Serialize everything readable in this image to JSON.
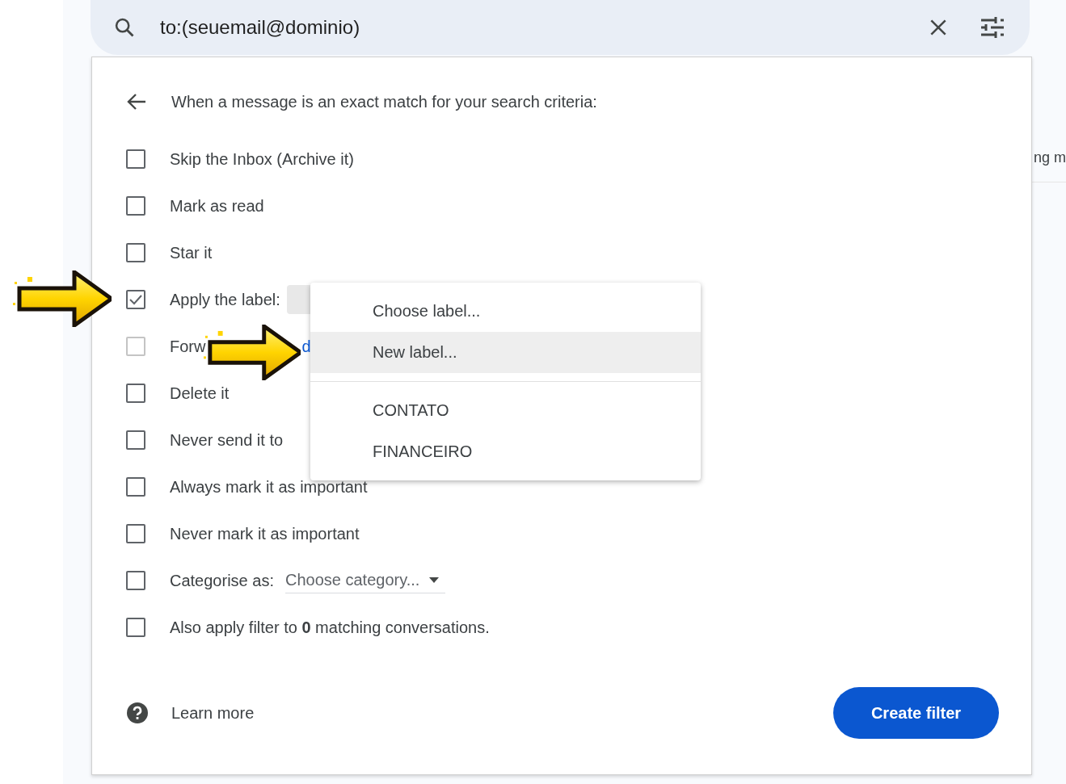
{
  "search": {
    "value": "to:(seuemail@dominio)"
  },
  "background_text": "ng m",
  "filter": {
    "heading": "When a message is an exact match for your search criteria:",
    "options": [
      {
        "kind": "plain",
        "label": "Skip the Inbox (Archive it)",
        "checked": false,
        "disabled": false
      },
      {
        "kind": "plain",
        "label": "Mark as read",
        "checked": false,
        "disabled": false
      },
      {
        "kind": "plain",
        "label": "Star it",
        "checked": false,
        "disabled": false
      },
      {
        "kind": "label_select",
        "label": "Apply the label:",
        "checked": true,
        "disabled": false
      },
      {
        "kind": "link",
        "label": "Forw",
        "link": "d",
        "checked": false,
        "disabled": true
      },
      {
        "kind": "plain",
        "label": "Delete it",
        "checked": false,
        "disabled": false
      },
      {
        "kind": "plain",
        "label": "Never send it to",
        "checked": false,
        "disabled": false
      },
      {
        "kind": "plain",
        "label": "Always mark it as important",
        "checked": false,
        "disabled": false
      },
      {
        "kind": "plain",
        "label": "Never mark it as important",
        "checked": false,
        "disabled": false
      },
      {
        "kind": "category",
        "label": "Categorise as:",
        "select": "Choose category...",
        "checked": false,
        "disabled": false
      },
      {
        "kind": "plain",
        "label": "Also apply filter to **0** matching conversations.",
        "checked": false,
        "disabled": false
      }
    ],
    "learn_more": "Learn more",
    "submit": "Create filter"
  },
  "label_menu": {
    "sections": [
      {
        "items": [
          {
            "label": "Choose label...",
            "selected": false
          },
          {
            "label": "New label...",
            "selected": true
          }
        ]
      },
      {
        "items": [
          {
            "label": "CONTATO",
            "selected": false
          },
          {
            "label": "FINANCEIRO",
            "selected": false
          }
        ]
      }
    ]
  }
}
